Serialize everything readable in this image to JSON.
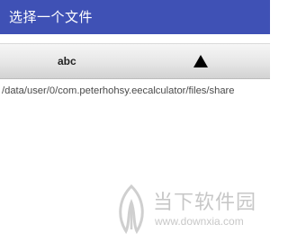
{
  "app_bar": {
    "title": "选择一个文件"
  },
  "up_button": {
    "label": "abc",
    "icon": "triangle-up-icon"
  },
  "current_path": "/data/user/0/com.peterhohsy.eecalculator/files/share",
  "watermark": {
    "name": "当下软件园",
    "url": "www.downxia.com",
    "icon": "leaf-logo"
  },
  "colors": {
    "app_bar": "#3f51b5",
    "app_bar_text": "#ffffff",
    "path_text": "#4a4a4a"
  }
}
